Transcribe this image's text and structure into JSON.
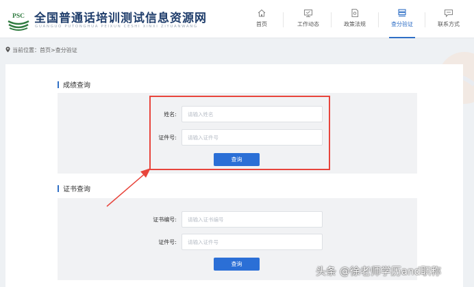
{
  "site": {
    "logo_text": "PSC",
    "title": "全国普通话培训测试信息资源网",
    "subtitle": "GUANGUO PUTONGHUA PEIXUN CESHI XINXI ZIYUANWANG"
  },
  "nav": [
    {
      "label": "首页",
      "icon": "home-icon"
    },
    {
      "label": "工作动态",
      "icon": "monitor-icon"
    },
    {
      "label": "政策法规",
      "icon": "document-icon"
    },
    {
      "label": "查分验证",
      "icon": "stack-icon",
      "active": true
    },
    {
      "label": "联系方式",
      "icon": "message-icon"
    }
  ],
  "breadcrumb": "当前位置：首页>查分验证",
  "score_query": {
    "title": "成绩查询",
    "name_label": "姓名:",
    "name_placeholder": "请输入姓名",
    "id_label": "证件号:",
    "id_placeholder": "请输入证件号",
    "button": "查询"
  },
  "cert_query": {
    "title": "证书查询",
    "cert_no_label": "证书编号:",
    "cert_no_placeholder": "请输入证书编号",
    "id_label": "证件号:",
    "id_placeholder": "请输入证件号",
    "button": "查询"
  },
  "annotation": {
    "color": "#e8443b"
  },
  "watermark": "头条 @徐老师学历and职称",
  "colors": {
    "accent": "#2b6fd6",
    "title": "#1f3d6b"
  }
}
